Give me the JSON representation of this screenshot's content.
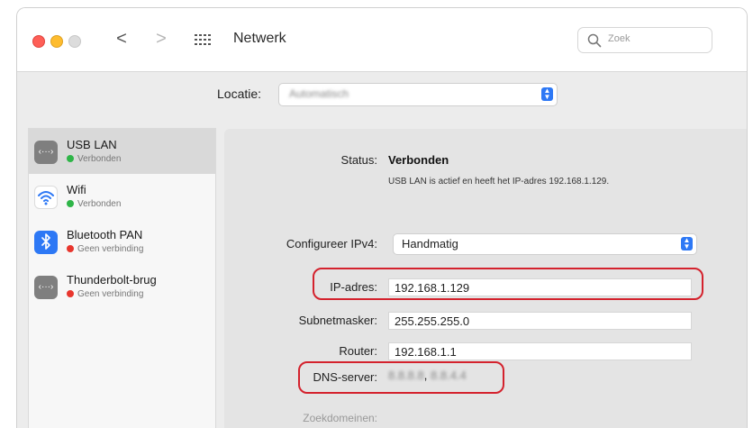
{
  "window": {
    "title": "Netwerk",
    "search_placeholder": "Zoek"
  },
  "toolbar": {
    "back_glyph": "<",
    "forward_glyph": ">"
  },
  "location": {
    "label": "Locatie:",
    "value": "Automatisch"
  },
  "sidebar": {
    "items": [
      {
        "name": "USB LAN",
        "status": "Verbonden",
        "status_color": "#2fb548",
        "icon": "usb-lan-icon",
        "icon_color": "#7f7f7f",
        "selected": true
      },
      {
        "name": "Wifi",
        "status": "Verbonden",
        "status_color": "#2fb548",
        "icon": "wifi-icon",
        "icon_color": "#ffffff",
        "selected": false
      },
      {
        "name": "Bluetooth PAN",
        "status": "Geen verbinding",
        "status_color": "#e8362d",
        "icon": "bluetooth-icon",
        "icon_color": "#2d78f5",
        "selected": false
      },
      {
        "name": "Thunderbolt-brug",
        "status": "Geen verbinding",
        "status_color": "#e8362d",
        "icon": "thunderbolt-bridge-icon",
        "icon_color": "#7f7f7f",
        "selected": false
      }
    ]
  },
  "detail": {
    "status_label": "Status:",
    "status_value": "Verbonden",
    "status_description": "USB LAN is actief en heeft het IP-adres 192.168.1.129.",
    "configure_label": "Configureer IPv4:",
    "configure_value": "Handmatig",
    "ip_label": "IP-adres:",
    "ip_value": "192.168.1.129",
    "subnet_label": "Subnetmasker:",
    "subnet_value": "255.255.255.0",
    "router_label": "Router:",
    "router_value": "192.168.1.1",
    "dns_label": "DNS-server:",
    "dns_value_1": "8.8.8.8",
    "dns_separator": ",",
    "dns_value_2": "8.8.4.4",
    "search_domains_label": "Zoekdomeinen:"
  },
  "colors": {
    "highlight_ring": "#d4222d",
    "accent": "#2d78f5"
  }
}
